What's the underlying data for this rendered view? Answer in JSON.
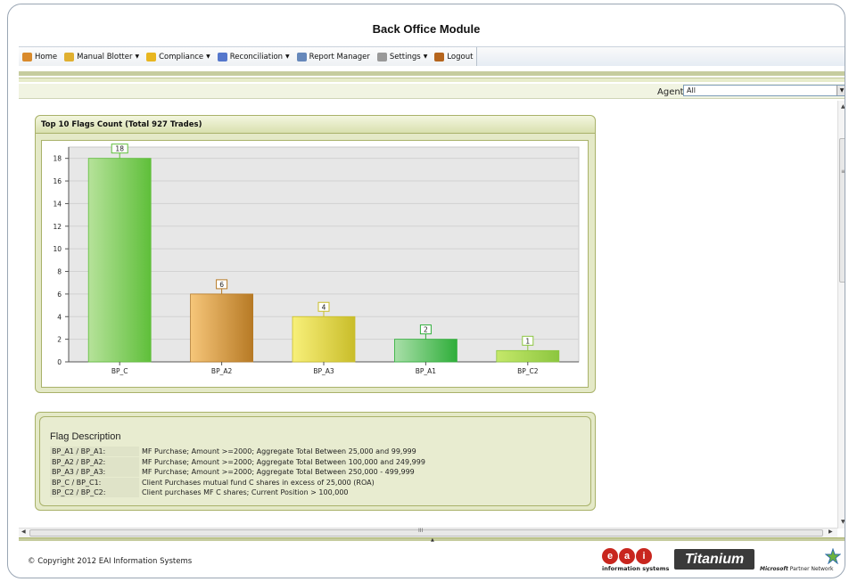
{
  "app": {
    "title": "Back Office Module"
  },
  "menu": {
    "items": [
      {
        "label": "Home",
        "icon": "home-icon",
        "color": "#d98a2b",
        "dropdown": false
      },
      {
        "label": "Manual Blotter",
        "icon": "shield-icon",
        "color": "#e0b030",
        "dropdown": true
      },
      {
        "label": "Compliance",
        "icon": "star-icon",
        "color": "#e8b620",
        "dropdown": true
      },
      {
        "label": "Reconciliation",
        "icon": "pencil-icon",
        "color": "#5577cc",
        "dropdown": true
      },
      {
        "label": "Report Manager",
        "icon": "document-icon",
        "color": "#6688bb",
        "dropdown": false
      },
      {
        "label": "Settings",
        "icon": "gear-icon",
        "color": "#999999",
        "dropdown": true
      },
      {
        "label": "Logout",
        "icon": "door-icon",
        "color": "#b5651d",
        "dropdown": false
      }
    ]
  },
  "agent": {
    "label": "Agent",
    "selected": "All"
  },
  "chart_panel": {
    "title": "Top 10 Flags Count (Total 927 Trades)"
  },
  "chart_data": {
    "type": "bar",
    "title": "",
    "xlabel": "",
    "ylabel": "",
    "categories": [
      "BP_C",
      "BP_A2",
      "BP_A3",
      "BP_A1",
      "BP_C2"
    ],
    "values": [
      18,
      6,
      4,
      2,
      1
    ],
    "ylim": [
      0,
      19
    ],
    "yticks": [
      0,
      2,
      4,
      6,
      8,
      10,
      12,
      14,
      16,
      18
    ],
    "colors": [
      [
        "#b6e29a",
        "#5fbf3a"
      ],
      [
        "#f6c67a",
        "#b77a25"
      ],
      [
        "#f8f07a",
        "#c9bd2a"
      ],
      [
        "#a9dfa9",
        "#2fae3a"
      ],
      [
        "#c5e86a",
        "#8cc63f"
      ]
    ],
    "grid": true,
    "legend": "none"
  },
  "flag_description": {
    "title": "Flag Description",
    "rows": [
      {
        "code": "BP_A1 / BP_A1:",
        "desc": "MF Purchase; Amount >=2000; Aggregate Total Between 25,000 and 99,999"
      },
      {
        "code": "BP_A2 / BP_A2:",
        "desc": "MF Purchase; Amount >=2000; Aggregate Total Between 100,000 and 249,999"
      },
      {
        "code": "BP_A3 / BP_A3:",
        "desc": "MF Purchase; Amount >=2000; Aggregate Total Between 250,000 - 499,999"
      },
      {
        "code": "BP_C / BP_C1:",
        "desc": "Client Purchases mutual fund C shares in excess of 25,000 (ROA)"
      },
      {
        "code": "BP_C2 / BP_C2:",
        "desc": "Client purchases MF C shares; Current Position > 100,000"
      }
    ]
  },
  "footer": {
    "copyright": "© Copyright 2012 EAI Information Systems",
    "eai_letters": [
      "e",
      "a",
      "i"
    ],
    "eai_sub": "information systems",
    "titanium": "Titanium",
    "ms_brand": "Microsoft",
    "ms_text": "Partner Network"
  }
}
